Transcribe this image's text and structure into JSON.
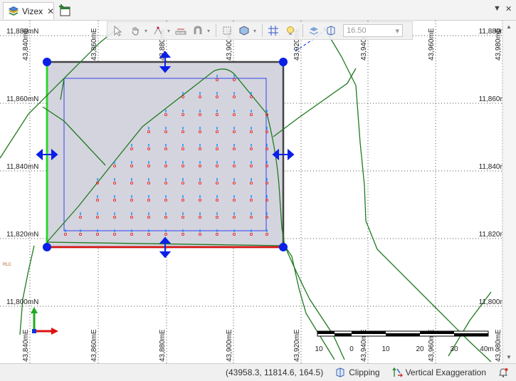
{
  "tab": {
    "title": "Vizex",
    "close": "✕"
  },
  "window": {
    "dropdown": "▼",
    "close": "✕"
  },
  "toolbar": {
    "section_value": "16.50",
    "caret": "▾"
  },
  "grid": {
    "northings": [
      "11,880mN",
      "11,860mN",
      "11,840mN",
      "11,820mN",
      "11,800mN"
    ],
    "eastings": [
      "43,840mE",
      "43,860mE",
      "43,880mE",
      "43,900mE",
      "43,920mE",
      "43,940mE",
      "43,960mE",
      "43,980mE"
    ]
  },
  "scalebar": {
    "labels": [
      "10",
      "0",
      "10",
      "20",
      "30",
      "40m"
    ]
  },
  "map_labels": {
    "side_label": "RLC"
  },
  "status": {
    "coordinates": "(43958.3, 11814.6, 164.5)",
    "clipping": "Clipping",
    "vertical_exaggeration": "Vertical Exaggeration"
  },
  "colors": {
    "selection_fill": "#d4d4de",
    "selection_border": "#444444",
    "handle": "#0a1fe8",
    "boundary": "#1e7a1e",
    "edge_left": "#22dd22",
    "edge_bottom": "#dd1111",
    "grid": "#555555"
  }
}
